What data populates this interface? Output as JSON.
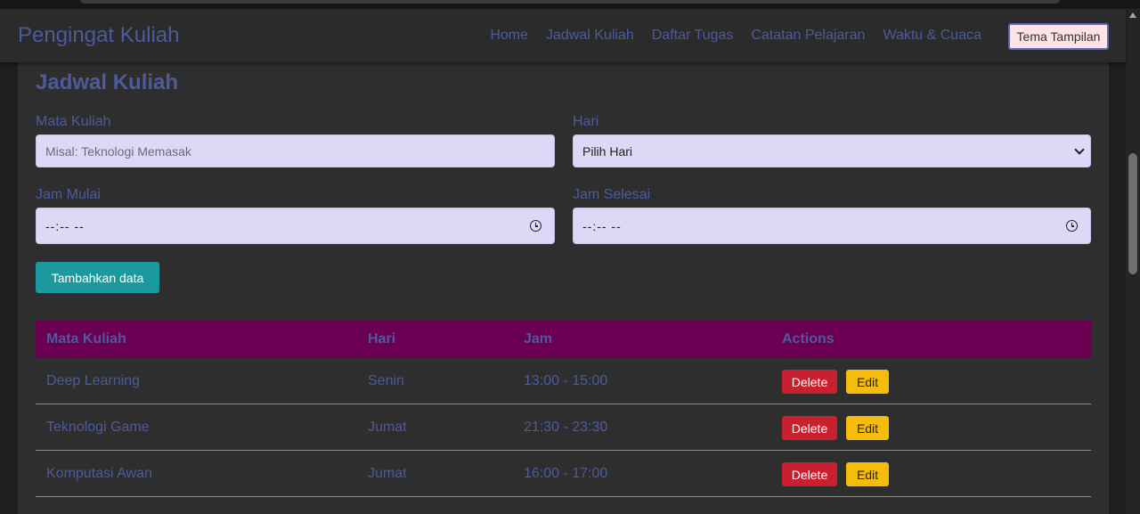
{
  "navbar": {
    "brand": "Pengingat Kuliah",
    "links": [
      "Home",
      "Jadwal Kuliah",
      "Daftar Tugas",
      "Catatan Pelajaran",
      "Waktu & Cuaca"
    ],
    "theme_button": "Tema Tampilan"
  },
  "form": {
    "title": "Jadwal Kuliah",
    "course_label": "Mata Kuliah",
    "course_placeholder": "Misal: Teknologi Memasak",
    "day_label": "Hari",
    "day_selected": "Pilih Hari",
    "start_label": "Jam Mulai",
    "start_value": "--:-- --",
    "end_label": "Jam Selesai",
    "end_value": "--:-- --",
    "submit_label": "Tambahkan data"
  },
  "table": {
    "headers": [
      "Mata Kuliah",
      "Hari",
      "Jam",
      "Actions"
    ],
    "rows": [
      {
        "course": "Deep Learning",
        "day": "Senin",
        "time": "13:00 - 15:00"
      },
      {
        "course": "Teknologi Game",
        "day": "Jumat",
        "time": "21:30 - 23:30"
      },
      {
        "course": "Komputasi Awan",
        "day": "Jumat",
        "time": "16:00 - 17:00"
      }
    ],
    "delete_label": "Delete",
    "edit_label": "Edit"
  },
  "colors": {
    "accent": "#4e5a9c",
    "header_bg": "#6b0052",
    "submit_bg": "#1a9a9e",
    "delete_bg": "#c8202f",
    "edit_bg": "#f5bd09",
    "input_bg": "#ddd8f6"
  }
}
